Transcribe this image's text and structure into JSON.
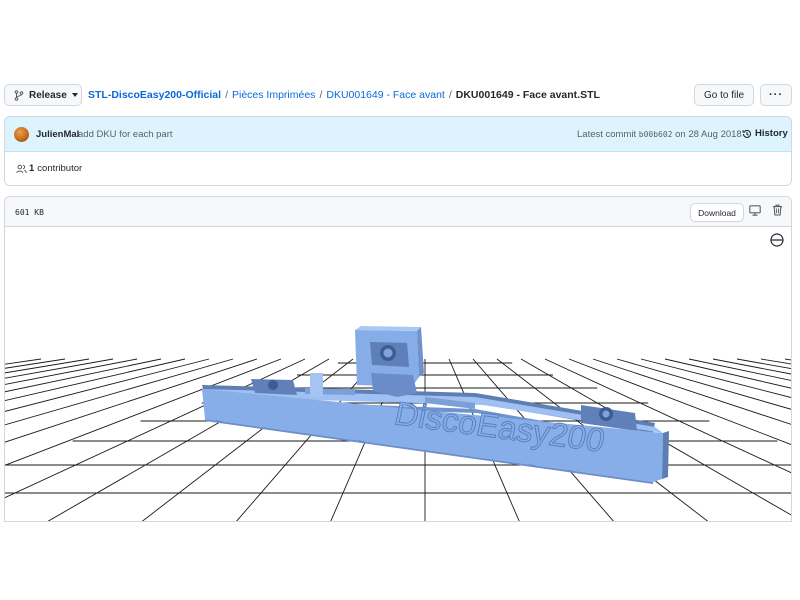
{
  "header": {
    "branch_label": "Release",
    "breadcrumb": {
      "repo": "STL-DiscoEasy200-Official",
      "folder1": "Pièces Imprimées",
      "folder2": "DKU001649 - Face avant",
      "file": "DKU001649 - Face avant.STL"
    },
    "goto_file_label": "Go to file",
    "more_label": "···"
  },
  "commit": {
    "author": "JulienMal",
    "message": "add DKU for each part",
    "latest_prefix": "Latest commit",
    "sha": "b00b602",
    "date_text": "on 28 Aug 2018",
    "history_label": "History"
  },
  "contributors": {
    "count": "1",
    "label": "contributor"
  },
  "file": {
    "size": "601 KB",
    "download_label": "Download"
  },
  "model": {
    "embossed_text": "DiscoEasy200",
    "color": "#87aee8"
  }
}
